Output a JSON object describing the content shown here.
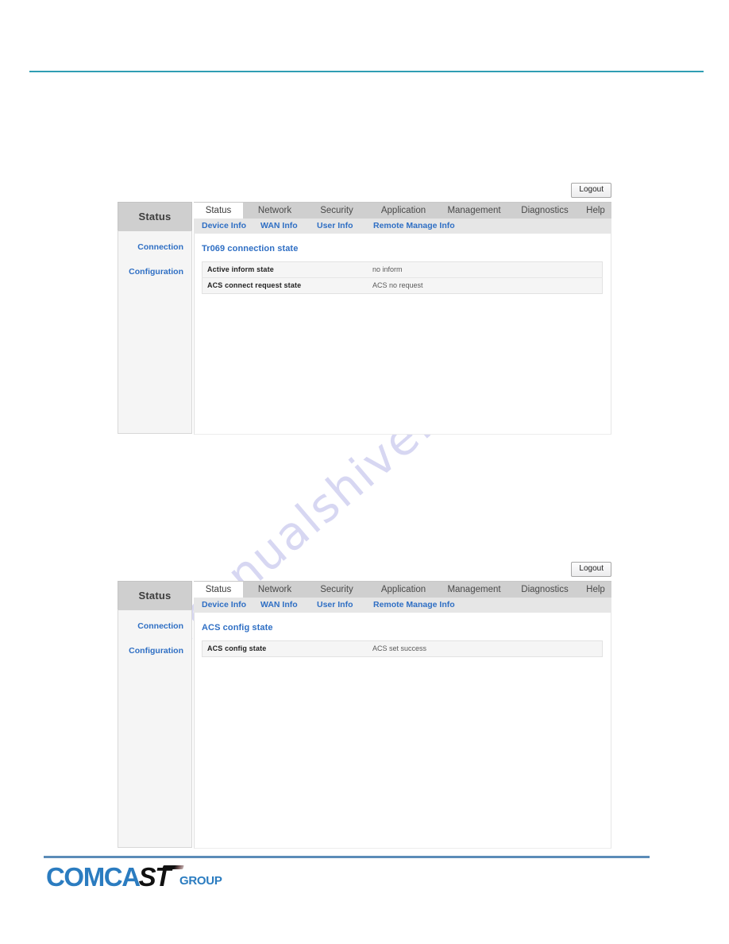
{
  "watermark": {
    "text": "manualshive.com"
  },
  "brand": {
    "logo_part1": "COMCA",
    "logo_part2": "ST",
    "logo_part3": "GROUP"
  },
  "colors": {
    "top_rule": "#2f9eb3",
    "bottom_rule": "#5b8cb8",
    "link_blue": "#2f6fc4",
    "brand_blue": "#2b7cc0",
    "tabbar_gray": "#cfcfcf",
    "subtabbar_gray": "#e6e6e6",
    "table_gray": "#f5f5f5",
    "watermark": "#c9c9ee"
  },
  "panels": [
    {
      "logout_label": "Logout",
      "sidebar": {
        "header": "Status",
        "items": [
          {
            "label": "Connection"
          },
          {
            "label": "Configuration"
          }
        ]
      },
      "tabs": [
        {
          "label": "Status",
          "active": true
        },
        {
          "label": "Network",
          "active": false
        },
        {
          "label": "Security",
          "active": false
        },
        {
          "label": "Application",
          "active": false
        },
        {
          "label": "Management",
          "active": false
        },
        {
          "label": "Diagnostics",
          "active": false
        },
        {
          "label": "Help",
          "active": false
        }
      ],
      "subtabs": [
        {
          "label": "Device Info"
        },
        {
          "label": "WAN Info"
        },
        {
          "label": "User Info"
        },
        {
          "label": "Remote Manage Info"
        }
      ],
      "section_title": "Tr069 connection state",
      "table": {
        "rows": [
          {
            "key": "Active inform state",
            "value": "no inform"
          },
          {
            "key": "ACS connect request state",
            "value": "ACS no request"
          }
        ]
      }
    },
    {
      "logout_label": "Logout",
      "sidebar": {
        "header": "Status",
        "items": [
          {
            "label": "Connection"
          },
          {
            "label": "Configuration"
          }
        ]
      },
      "tabs": [
        {
          "label": "Status",
          "active": true
        },
        {
          "label": "Network",
          "active": false
        },
        {
          "label": "Security",
          "active": false
        },
        {
          "label": "Application",
          "active": false
        },
        {
          "label": "Management",
          "active": false
        },
        {
          "label": "Diagnostics",
          "active": false
        },
        {
          "label": "Help",
          "active": false
        }
      ],
      "subtabs": [
        {
          "label": "Device Info"
        },
        {
          "label": "WAN Info"
        },
        {
          "label": "User Info"
        },
        {
          "label": "Remote Manage Info"
        }
      ],
      "section_title": "ACS config state",
      "table": {
        "rows": [
          {
            "key": "ACS config state",
            "value": "ACS set success"
          }
        ]
      }
    }
  ]
}
